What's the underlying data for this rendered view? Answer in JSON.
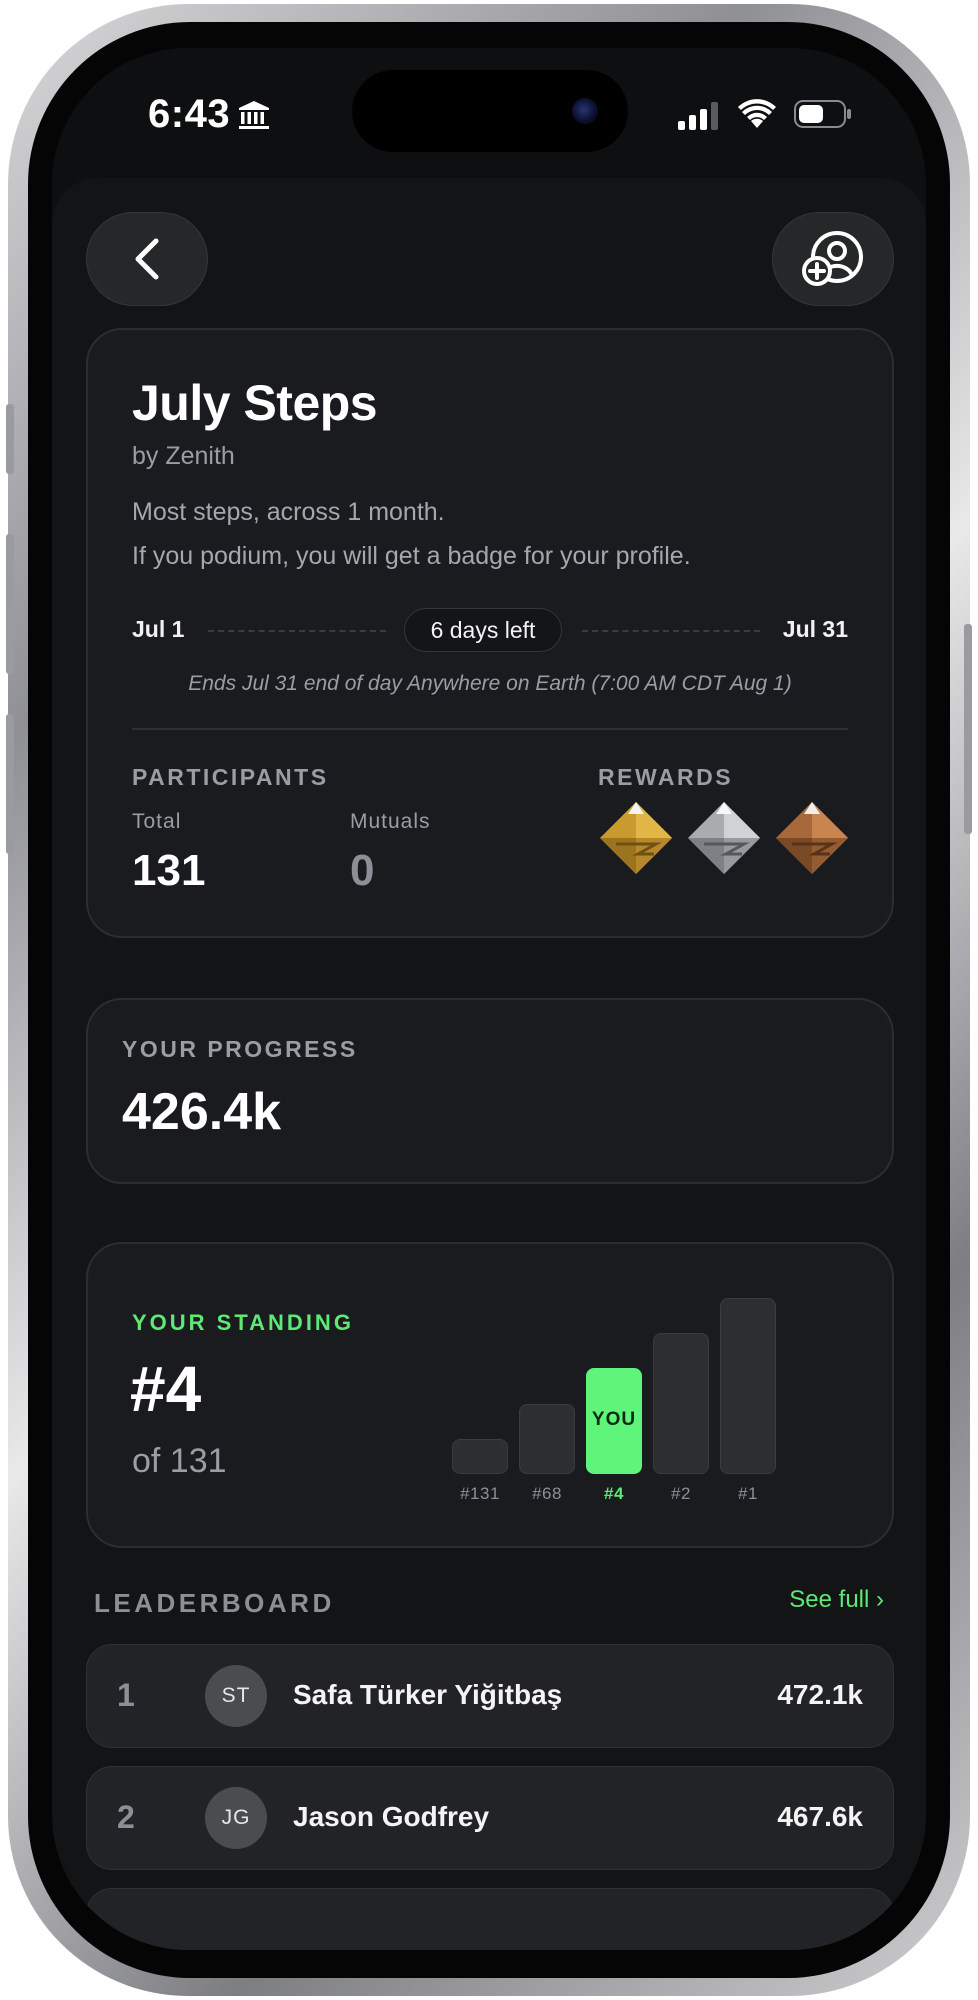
{
  "status_bar": {
    "time": "6:43"
  },
  "header": {
    "back_icon": "chevron-left-icon",
    "invite_icon": "add-user-icon"
  },
  "challenge": {
    "title": "July Steps",
    "byline": "by Zenith",
    "description_1": "Most steps, across 1 month.",
    "description_2": "If you podium, you will get a badge for your profile.",
    "start_date": "Jul 1",
    "end_date": "Jul 31",
    "time_left": "6 days left",
    "ends_note": "Ends Jul 31 end of day Anywhere on Earth (7:00 AM CDT Aug 1)"
  },
  "participants": {
    "label": "PARTICIPANTS",
    "total_label": "Total",
    "total": "131",
    "mutuals_label": "Mutuals",
    "mutuals": "0"
  },
  "rewards": {
    "label": "REWARDS",
    "badges": [
      "gold-badge-icon",
      "silver-badge-icon",
      "bronze-badge-icon"
    ]
  },
  "progress": {
    "label": "YOUR PROGRESS",
    "value": "426.4k"
  },
  "standing": {
    "label": "YOUR STANDING",
    "rank": "#4",
    "of_text": "of 131",
    "accent_color": "#5ee876",
    "bars": [
      {
        "label": "#131",
        "level": 0.2,
        "you": false
      },
      {
        "label": "#68",
        "level": 0.4,
        "you": false
      },
      {
        "label": "#4",
        "level": 0.6,
        "you": true,
        "text": "YOU"
      },
      {
        "label": "#2",
        "level": 0.8,
        "you": false
      },
      {
        "label": "#1",
        "level": 1.0,
        "you": false
      }
    ]
  },
  "leaderboard": {
    "label": "LEADERBOARD",
    "see_full": "See full ›",
    "rows": [
      {
        "rank": "1",
        "initials": "ST",
        "name": "Safa Türker Yiğitbaş",
        "score": "472.1k"
      },
      {
        "rank": "2",
        "initials": "JG",
        "name": "Jason Godfrey",
        "score": "467.6k"
      }
    ]
  }
}
